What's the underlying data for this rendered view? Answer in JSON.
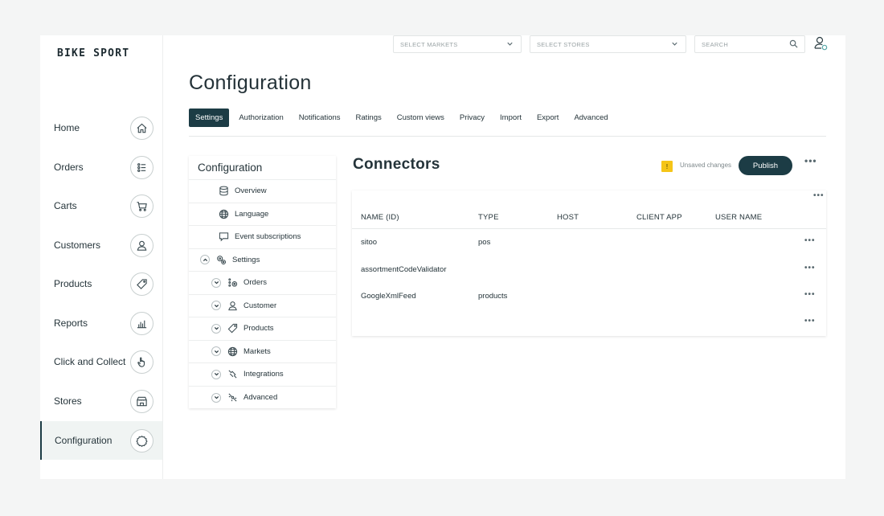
{
  "app": {
    "brand": "BIKE SPORT"
  },
  "sidebar": {
    "items": [
      {
        "label": "Home",
        "icon": "home-icon"
      },
      {
        "label": "Orders",
        "icon": "orders-list-icon"
      },
      {
        "label": "Carts",
        "icon": "cart-icon"
      },
      {
        "label": "Customers",
        "icon": "user-icon"
      },
      {
        "label": "Products",
        "icon": "tag-icon"
      },
      {
        "label": "Reports",
        "icon": "bar-chart-icon"
      },
      {
        "label": "Click and Collect",
        "icon": "hand-pointer-icon"
      },
      {
        "label": "Stores",
        "icon": "store-icon"
      },
      {
        "label": "Configuration",
        "icon": "gear-icon",
        "active": true
      }
    ]
  },
  "topbar": {
    "markets_placeholder": "SELECT MARKETS",
    "stores_placeholder": "SELECT STORES",
    "search_placeholder": "SEARCH"
  },
  "page": {
    "title": "Configuration"
  },
  "tabs": [
    {
      "label": "Settings",
      "active": true
    },
    {
      "label": "Authorization"
    },
    {
      "label": "Notifications"
    },
    {
      "label": "Ratings"
    },
    {
      "label": "Custom views"
    },
    {
      "label": "Privacy"
    },
    {
      "label": "Import"
    },
    {
      "label": "Export"
    },
    {
      "label": "Advanced"
    }
  ],
  "tree": {
    "title": "Configuration",
    "items": [
      {
        "label": "Overview",
        "icon": "database-icon"
      },
      {
        "label": "Language",
        "icon": "globe-icon"
      },
      {
        "label": "Event subscriptions",
        "icon": "chat-bubble-icon"
      },
      {
        "label": "Settings",
        "icon": "gears-icon",
        "toggle": "up"
      },
      {
        "label": "Orders",
        "icon": "orders-list-icon",
        "toggle": "down"
      },
      {
        "label": "Customer",
        "icon": "user-icon",
        "toggle": "down"
      },
      {
        "label": "Products",
        "icon": "tag-icon",
        "toggle": "down"
      },
      {
        "label": "Markets",
        "icon": "globe-icon",
        "toggle": "down"
      },
      {
        "label": "Integrations",
        "icon": "integrations-icon",
        "toggle": "down"
      },
      {
        "label": "Advanced",
        "icon": "advanced-icon",
        "toggle": "down"
      }
    ]
  },
  "connectors": {
    "title": "Connectors",
    "warning_badge": "!",
    "unsaved_label": "Unsaved changes",
    "publish_label": "Publish",
    "more_label": "•••",
    "columns": [
      "NAME (ID)",
      "TYPE",
      "HOST",
      "CLIENT APP",
      "USER NAME"
    ],
    "rows": [
      {
        "name": "sitoo",
        "type": "pos",
        "host": "",
        "client_app": "",
        "user_name": ""
      },
      {
        "name": "assortmentCodeValidator",
        "type": "",
        "host": "",
        "client_app": "",
        "user_name": ""
      },
      {
        "name": "GoogleXmlFeed",
        "type": "products",
        "host": "",
        "client_app": "",
        "user_name": ""
      },
      {
        "name": "",
        "type": "",
        "host": "",
        "client_app": "",
        "user_name": ""
      }
    ]
  },
  "colors": {
    "primary": "#1c3c45",
    "warning": "#f5c518",
    "active_nav_bg": "#f0f4f3"
  }
}
